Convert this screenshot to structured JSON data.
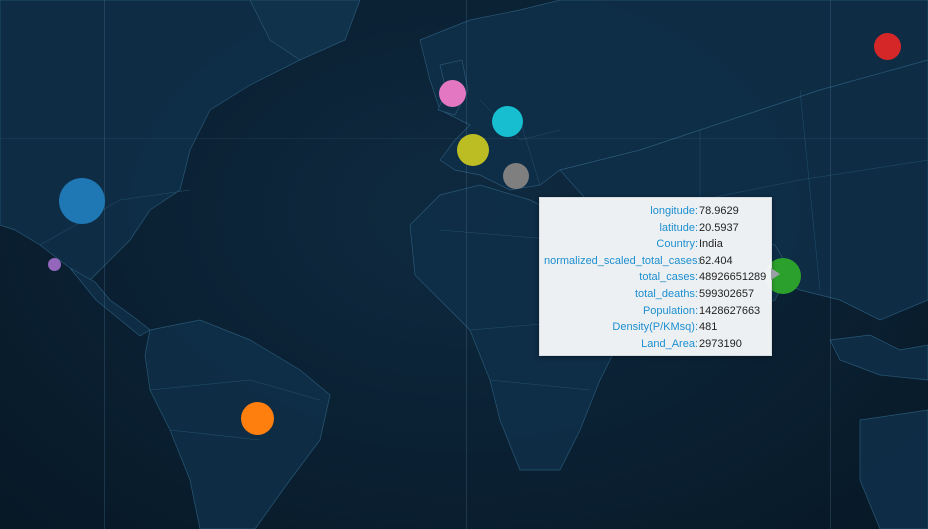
{
  "tooltip": {
    "rows": [
      {
        "key": "longitude:",
        "value": "78.9629"
      },
      {
        "key": "latitude:",
        "value": "20.5937"
      },
      {
        "key": "Country:",
        "value": "India"
      },
      {
        "key": "normalized_scaled_total_cases:",
        "value": "62.404"
      },
      {
        "key": "total_cases:",
        "value": "48926651289"
      },
      {
        "key": "total_deaths:",
        "value": "599302657"
      },
      {
        "key": "Population:",
        "value": "1428627663"
      },
      {
        "key": "Density(P/KMsq):",
        "value": "481"
      },
      {
        "key": "Land_Area:",
        "value": "2973190"
      }
    ]
  },
  "bubbles": [
    {
      "name": "bubble-usa",
      "color": "#1f77b4"
    },
    {
      "name": "bubble-mexico",
      "color": "#9467bd"
    },
    {
      "name": "bubble-brazil",
      "color": "#ff7f0e"
    },
    {
      "name": "bubble-uk",
      "color": "#e377c2"
    },
    {
      "name": "bubble-germany",
      "color": "#17becf"
    },
    {
      "name": "bubble-france",
      "color": "#bcbd22"
    },
    {
      "name": "bubble-italy",
      "color": "#7f7f7f"
    },
    {
      "name": "bubble-india",
      "color": "#2ca02c"
    },
    {
      "name": "bubble-japan-or-korea",
      "color": "#d62728"
    }
  ]
}
